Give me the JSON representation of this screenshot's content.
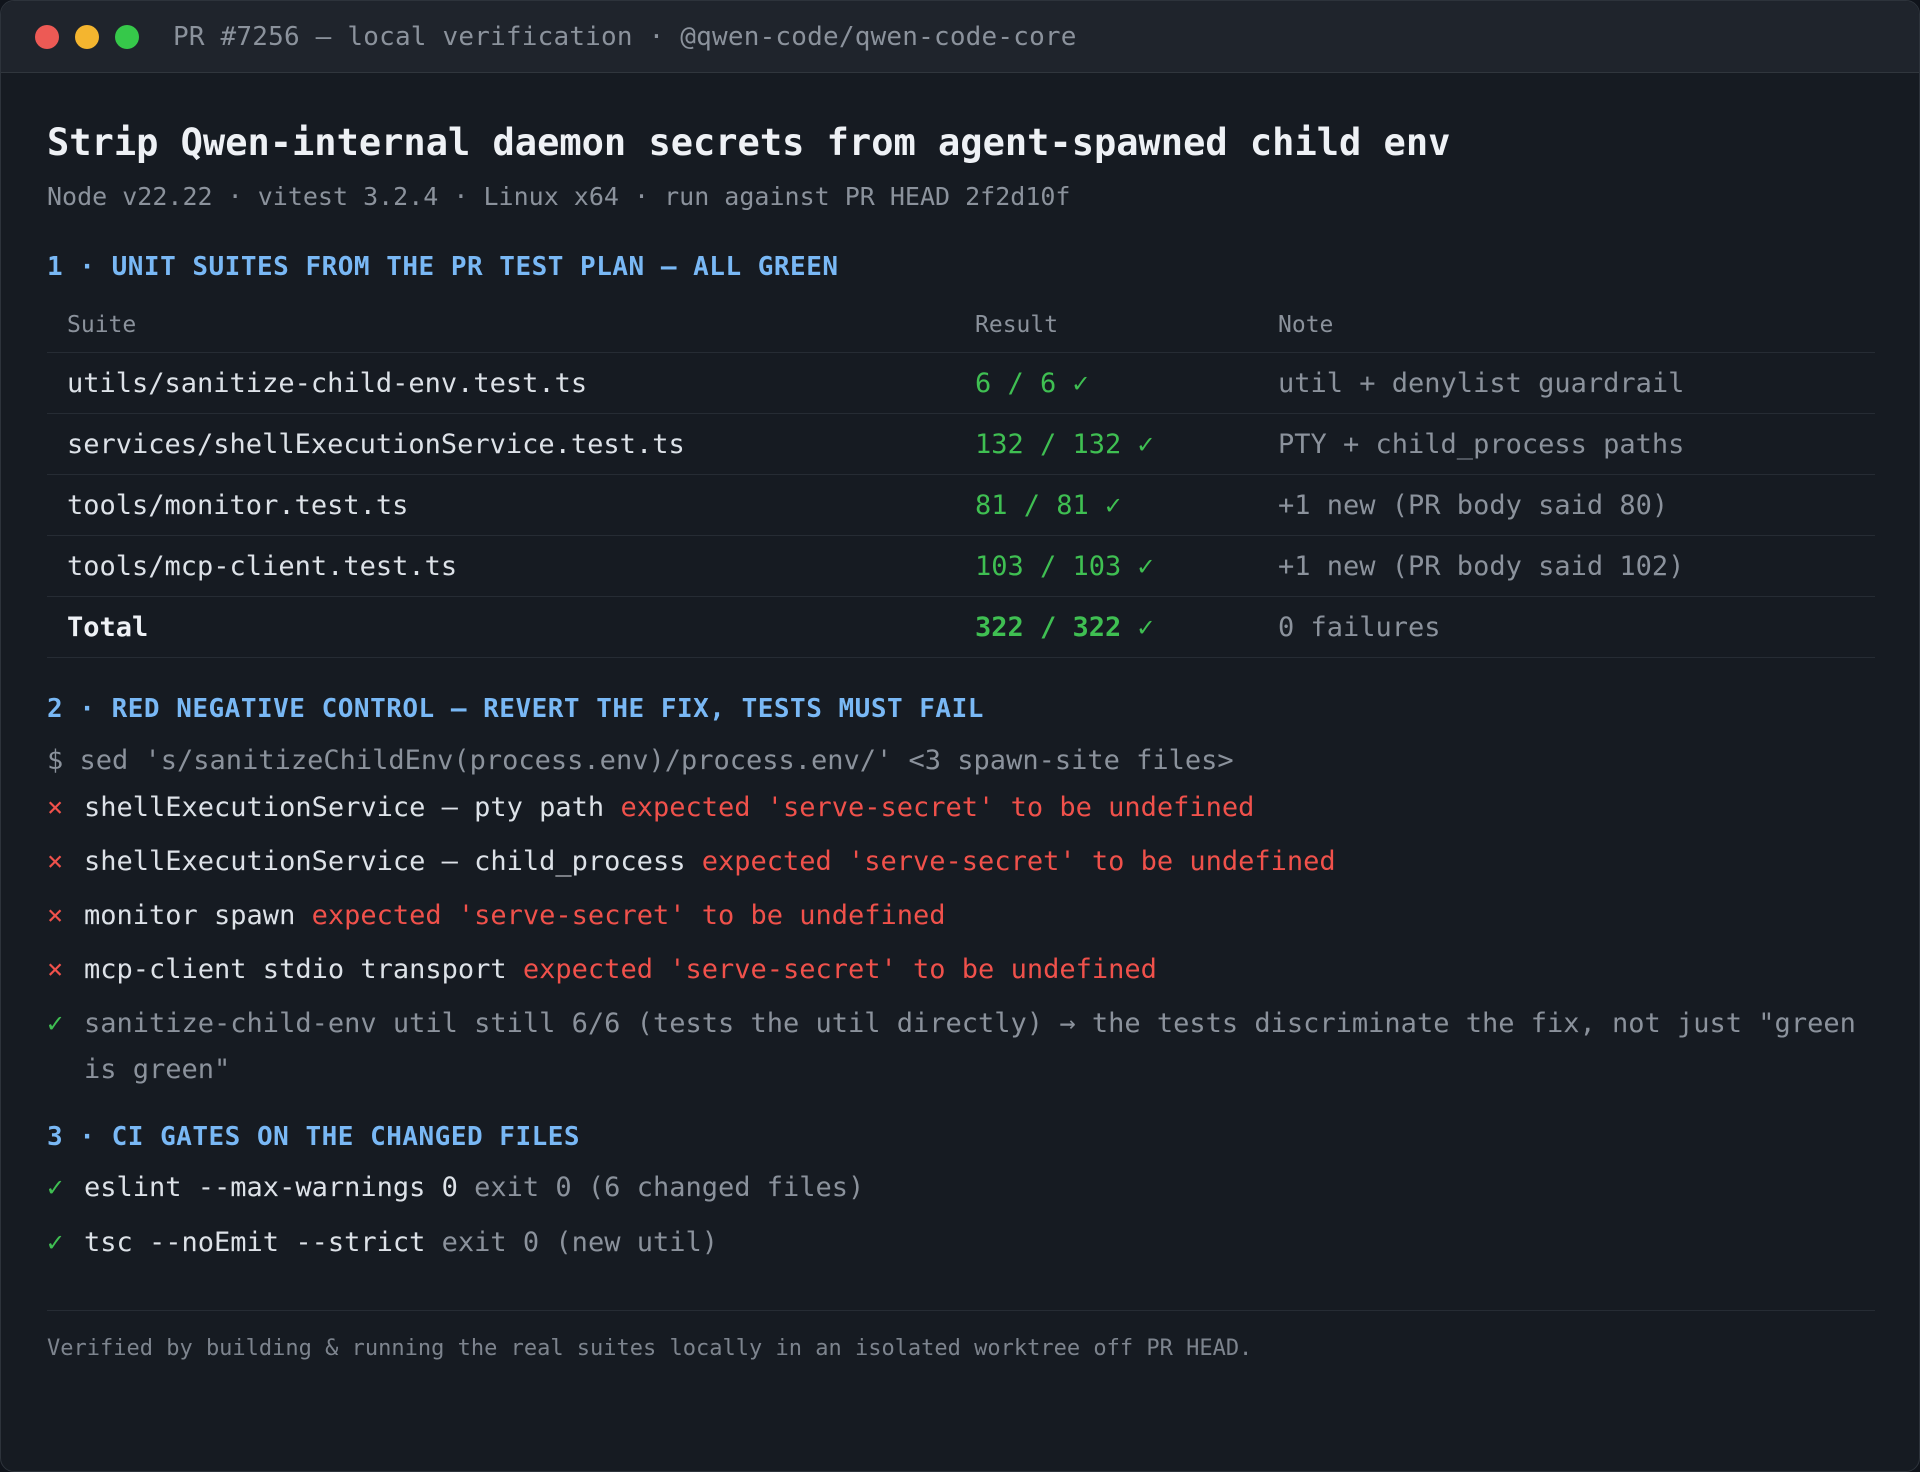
{
  "window": {
    "title": "PR #7256 — local verification · @qwen-code/qwen-code-core"
  },
  "page": {
    "title": "Strip Qwen-internal daemon secrets from agent-spawned child env",
    "subtitle": "Node v22.22 · vitest 3.2.4 · Linux x64 · run against PR HEAD 2f2d10f"
  },
  "section1": {
    "heading": "1 · UNIT SUITES FROM THE PR TEST PLAN — ALL GREEN",
    "columns": {
      "suite": "Suite",
      "result": "Result",
      "note": "Note"
    },
    "rows": [
      {
        "suite": "utils/sanitize-child-env.test.ts",
        "result": "6 / 6 ✓",
        "note": "util + denylist guardrail"
      },
      {
        "suite": "services/shellExecutionService.test.ts",
        "result": "132 / 132 ✓",
        "note": "PTY + child_process paths"
      },
      {
        "suite": "tools/monitor.test.ts",
        "result": "81 / 81 ✓",
        "note": "+1 new (PR body said 80)"
      },
      {
        "suite": "tools/mcp-client.test.ts",
        "result": "103 / 103 ✓",
        "note": "+1 new (PR body said 102)"
      }
    ],
    "total": {
      "suite": "Total",
      "result": "322 / 322 ✓",
      "note": "0 failures"
    }
  },
  "section2": {
    "heading": "2 · RED NEGATIVE CONTROL — REVERT THE FIX, TESTS MUST FAIL",
    "command": "$ sed 's/sanitizeChildEnv(process.env)/process.env/' <3 spawn-site files>",
    "failures": [
      {
        "mark": "×",
        "label": "shellExecutionService — pty path",
        "error": "expected 'serve-secret' to be undefined"
      },
      {
        "mark": "×",
        "label": "shellExecutionService — child_process",
        "error": "expected 'serve-secret' to be undefined"
      },
      {
        "mark": "×",
        "label": "monitor spawn",
        "error": "expected 'serve-secret' to be undefined"
      },
      {
        "mark": "×",
        "label": "mcp-client stdio transport",
        "error": "expected 'serve-secret' to be undefined"
      }
    ],
    "pass_note": {
      "mark": "✓",
      "text": "sanitize-child-env util still 6/6 (tests the util directly) → the tests discriminate the fix, not just \"green is green\""
    }
  },
  "section3": {
    "heading": "3 · CI GATES ON THE CHANGED FILES",
    "gates": [
      {
        "mark": "✓",
        "command": "eslint --max-warnings 0",
        "detail": "exit 0 (6 changed files)"
      },
      {
        "mark": "✓",
        "command": "tsc --noEmit --strict",
        "detail": "exit 0 (new util)"
      }
    ]
  },
  "footer": {
    "text": "Verified by building & running the real suites locally in an isolated worktree off PR HEAD."
  },
  "colors": {
    "background": "#161b22",
    "titlebar": "#1f242c",
    "heading_accent": "#79b8f5",
    "pass_green": "#3fbf52",
    "fail_red": "#f0514b",
    "muted": "#8b929c",
    "traffic_red": "#ed5a55",
    "traffic_yellow": "#f4b52f",
    "traffic_green": "#36c84a"
  }
}
